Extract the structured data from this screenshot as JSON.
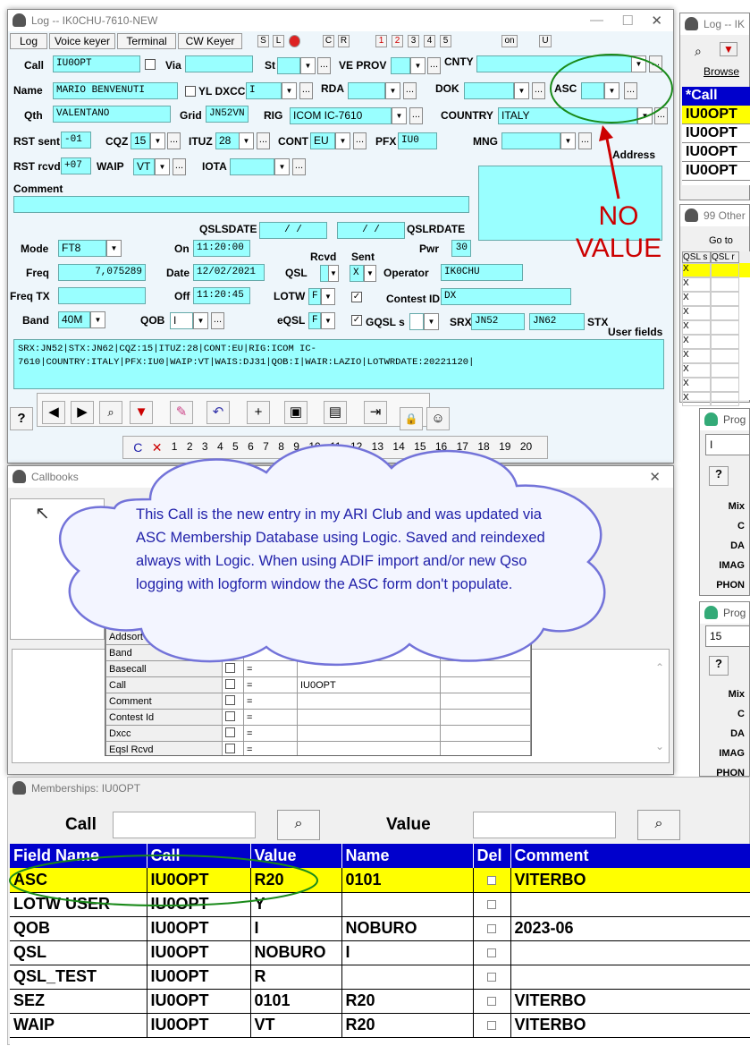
{
  "log": {
    "title": "Log -- IK0CHU-7610-NEW",
    "menu": [
      "Log",
      "Voice keyer",
      "Terminal",
      "CW Keyer"
    ],
    "small_btns": [
      "S",
      "L",
      "",
      "C",
      "R",
      "1",
      "2",
      "3",
      "4",
      "5",
      "on",
      "U"
    ],
    "labels": {
      "call": "Call",
      "via": "Via",
      "st": "St",
      "ve_prov": "VE PROV",
      "cnty": "CNTY",
      "name": "Name",
      "yl_dxcc": "YL DXCC",
      "rda": "RDA",
      "dok": "DOK",
      "asc": "ASC",
      "qth": "Qth",
      "grid": "Grid",
      "rig": "RIG",
      "country": "COUNTRY",
      "rst_sent": "RST sent",
      "cqz": "CQZ",
      "ituz": "ITUZ",
      "cont": "CONT",
      "pfx": "PFX",
      "mng": "MNG",
      "address": "Address",
      "rst_rcvd": "RST rcvd",
      "waip": "WAIP",
      "iota": "IOTA",
      "comment": "Comment",
      "qslsdate": "QSLSDATE",
      "qslrdate": "QSLRDATE",
      "rcvd": "Rcvd",
      "sent": "Sent",
      "mode": "Mode",
      "on": "On",
      "pwr": "Pwr",
      "freq": "Freq",
      "date": "Date",
      "qsl": "QSL",
      "operator": "Operator",
      "freq_tx": "Freq TX",
      "off": "Off",
      "lotw": "LOTW",
      "contest_id": "Contest ID",
      "band": "Band",
      "qob": "QOB",
      "eqsl": "eQSL",
      "gqsl": "GQSL s",
      "srx": "SRX",
      "stx": "STX",
      "user_fields": "User fields"
    },
    "values": {
      "call": "IU0OPT",
      "name": "MARIO BENVENUTI",
      "yl_dxcc": "I",
      "qth": "VALENTANO",
      "grid": "JN52VN",
      "rig": "ICOM IC-7610",
      "country": "ITALY",
      "rst_sent": "-01",
      "cqz": "15",
      "ituz": "28",
      "cont": "EU",
      "pfx": "IU0",
      "rst_rcvd": "+07",
      "waip": "VT",
      "qsls_date": "/   /",
      "qslr_date": "/   /",
      "mode": "FT8",
      "on": "11:20:00",
      "pwr": "30",
      "freq": "7,075289",
      "date": "12/02/2021",
      "qsl_sent": "X",
      "operator": "IK0CHU",
      "off": "11:20:45",
      "lotw_rcvd": "F",
      "contest_id": "DX",
      "band": "40M",
      "qob": "I",
      "eqsl_rcvd": "F",
      "srx": "JN52",
      "stx": "JN62",
      "user_fields": "SRX:JN52|STX:JN62|CQZ:15|ITUZ:28|CONT:EU|RIG:ICOM IC-7610|COUNTRY:ITALY|PFX:IU0|WAIP:VT|WAIS:DJ31|QOB:I|WAIR:LAZIO|LOTWRDATE:20221120|"
    },
    "pager": [
      "C",
      "✕",
      "1",
      "2",
      "3",
      "4",
      "5",
      "6",
      "7",
      "8",
      "9",
      "10",
      "11",
      "12",
      "13",
      "14",
      "15",
      "16",
      "17",
      "18",
      "19",
      "20"
    ]
  },
  "annotation": {
    "no_value": "NO\nVALUE",
    "cloud": "This Call is the new entry in my ARI Club and was updated via ASC Membership Database using Logic. Saved and reindexed always with Logic. When using ADIF import and/or new Qso logging with logform window the ASC form don't populate."
  },
  "callbooks": {
    "title": "Callbooks",
    "rows": [
      {
        "field": "Addsort",
        "op": "",
        "val": ""
      },
      {
        "field": "Band",
        "op": "=",
        "val": ""
      },
      {
        "field": "Basecall",
        "op": "=",
        "val": ""
      },
      {
        "field": "Call",
        "op": "=",
        "val": "IU0OPT"
      },
      {
        "field": "Comment",
        "op": "=",
        "val": ""
      },
      {
        "field": "Contest Id",
        "op": "=",
        "val": ""
      },
      {
        "field": "Dxcc",
        "op": "=",
        "val": ""
      },
      {
        "field": "Eqsl Rcvd",
        "op": "=",
        "val": ""
      }
    ]
  },
  "right_panel": {
    "log_title": "Log -- IK",
    "browse": "Browse",
    "call_header": "*Call",
    "calls": [
      "IU0OPT",
      "IU0OPT",
      "IU0OPT",
      "IU0OPT"
    ],
    "other_title": "99 Other",
    "go_to": "Go to",
    "qsl_headers": [
      "QSL s",
      "QSL r"
    ],
    "qsl_rows": [
      "X",
      "X",
      "X",
      "X",
      "X",
      "X",
      "X",
      "X",
      "X",
      "X"
    ],
    "prog1": {
      "title": "Prog",
      "val": "I",
      "labels": [
        "Mix",
        "C",
        "DA",
        "IMAG",
        "PHON"
      ]
    },
    "prog2": {
      "title": "Prog",
      "val": "15",
      "labels": [
        "Mix",
        "C",
        "DA",
        "IMAG",
        "PHON"
      ]
    }
  },
  "memberships": {
    "title": "Memberships: IU0OPT",
    "call_label": "Call",
    "value_label": "Value",
    "headers": [
      "Field Name",
      "Call",
      "Value",
      "Name",
      "Del",
      "Comment"
    ],
    "rows": [
      {
        "field": "ASC",
        "call": "IU0OPT",
        "value": "R20",
        "name": "0101",
        "comment": "VITERBO"
      },
      {
        "field": "LOTW USER",
        "call": "IU0OPT",
        "value": "Y",
        "name": "",
        "comment": ""
      },
      {
        "field": "QOB",
        "call": "IU0OPT",
        "value": "I",
        "name": "NOBURO",
        "comment": "2023-06"
      },
      {
        "field": "QSL",
        "call": "IU0OPT",
        "value": "NOBURO",
        "name": "I",
        "comment": ""
      },
      {
        "field": "QSL_TEST",
        "call": "IU0OPT",
        "value": "R",
        "name": "",
        "comment": ""
      },
      {
        "field": "SEZ",
        "call": "IU0OPT",
        "value": "0101",
        "name": "R20",
        "comment": "VITERBO"
      },
      {
        "field": "WAIP",
        "call": "IU0OPT",
        "value": "VT",
        "name": "R20",
        "comment": "VITERBO"
      }
    ]
  },
  "colors": {
    "field_bg": "#99ffff",
    "highlight": "#ffff00",
    "header_bg": "#0000cc",
    "annotation_red": "#cc0000",
    "circle_green": "#1a8a1a"
  }
}
